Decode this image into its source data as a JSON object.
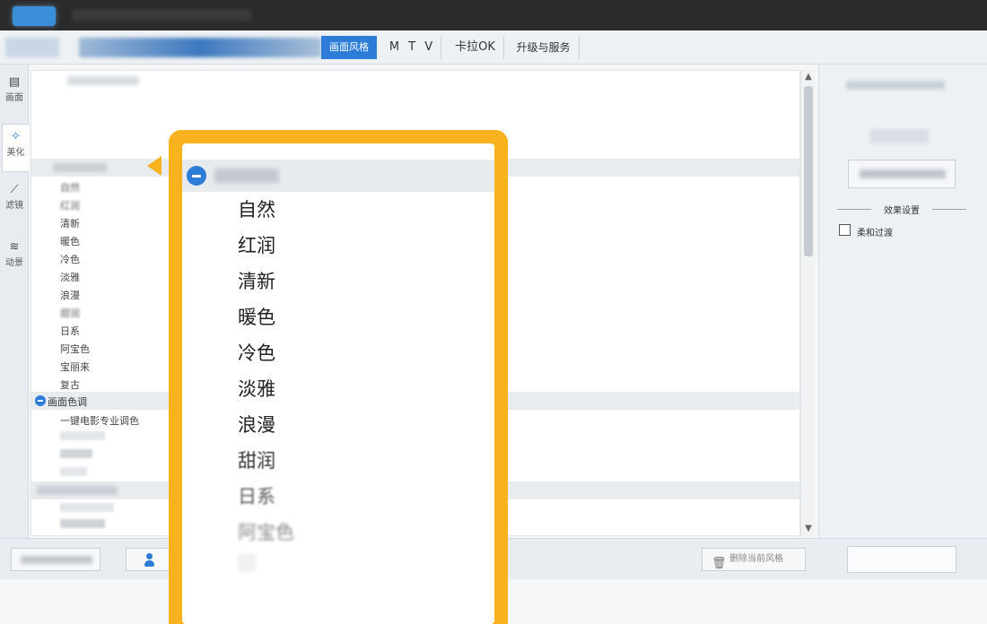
{
  "tabs": {
    "active": "画面风格",
    "mtv": "M T V",
    "karaoke": "卡拉OK",
    "upgrade": "升级与服务"
  },
  "vtabs": [
    {
      "label": "画面",
      "icon": "frame-icon"
    },
    {
      "label": "美化",
      "icon": "magic-wand-icon"
    },
    {
      "label": "滤镜",
      "icon": "filter-wand-icon"
    },
    {
      "label": "动景",
      "icon": "waves-icon"
    }
  ],
  "list": {
    "items_group1": [
      "自然",
      "红润",
      "清新",
      "暖色",
      "冷色",
      "淡雅",
      "浪漫",
      "甜润",
      "日系",
      "阿宝色",
      "宝丽来",
      "复古"
    ],
    "group2_label": "画面色调",
    "group2_first": "一键电影专业调色"
  },
  "right_panel": {
    "section_title": "效果设置",
    "checkbox_label": "柔和过渡"
  },
  "bottom": {
    "delete_label": "删除当前风格"
  },
  "zoom": {
    "items": [
      "自然",
      "红润",
      "清新",
      "暖色",
      "冷色",
      "淡雅",
      "浪漫",
      "甜润",
      "日系",
      "阿宝色"
    ]
  },
  "colors": {
    "accent": "#2c7cd8",
    "highlight": "#f7b21d"
  }
}
